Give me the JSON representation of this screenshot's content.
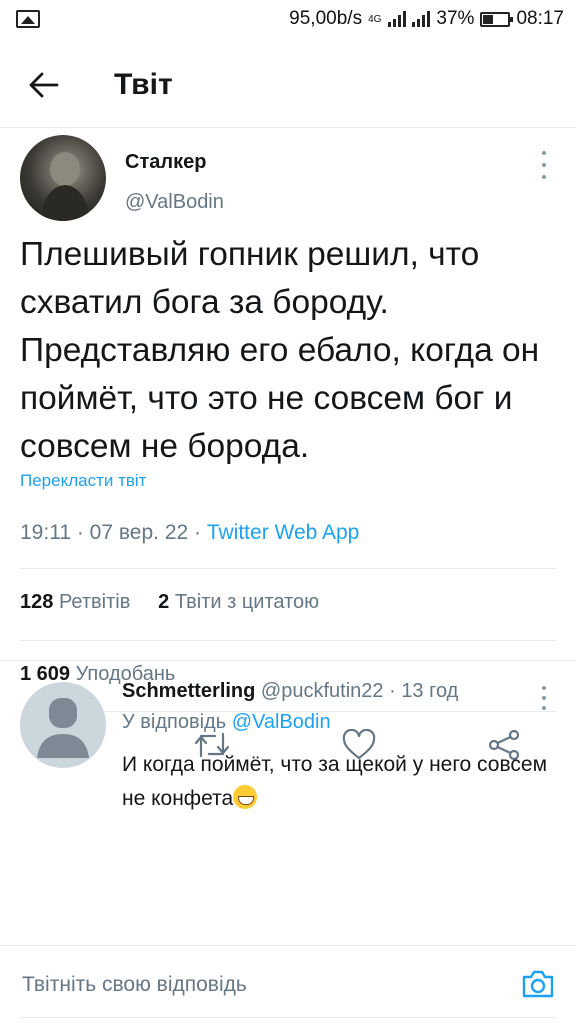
{
  "status_bar": {
    "net_speed": "95,00b/s",
    "network_type": "4G",
    "battery": "37%",
    "time": "08:17"
  },
  "header": {
    "back_icon": "arrow-left-icon",
    "title": "Твіт"
  },
  "tweet": {
    "author_name": "Сталкер",
    "author_handle": "@ValBodin",
    "text": "Плешивый гопник решил, что схватил бога за бороду. Представляю его ебало, когда он поймёт, что это не совсем бог и совсем не борода.",
    "translate_label": "Перекласти твіт",
    "time": "19:11",
    "date": "07 вер. 22",
    "app": "Twitter Web App",
    "retweets_count": "128",
    "retweets_label": "Ретвітів",
    "quotes_count": "2",
    "quotes_label": "Твіти з цитатою",
    "likes_count": "1 609",
    "likes_label": "Уподобань"
  },
  "actions": [
    "reply-icon",
    "retweet-icon",
    "like-icon",
    "share-icon"
  ],
  "reply": {
    "name": "Schmetterling",
    "handle": "@puckfutin22",
    "time": "13 год",
    "replying_to_label": "У відповідь",
    "replying_to_handle": "@ValBodin",
    "text": "И когда поймёт,  что за щекой у него совсем не конфета"
  },
  "compose": {
    "placeholder": "Твітніть свою відповідь",
    "camera_icon": "camera-icon"
  },
  "colors": {
    "accent": "#1da1f2",
    "secondary_text": "#657786",
    "primary_text": "#14171a",
    "divider": "#e6ecf0"
  }
}
